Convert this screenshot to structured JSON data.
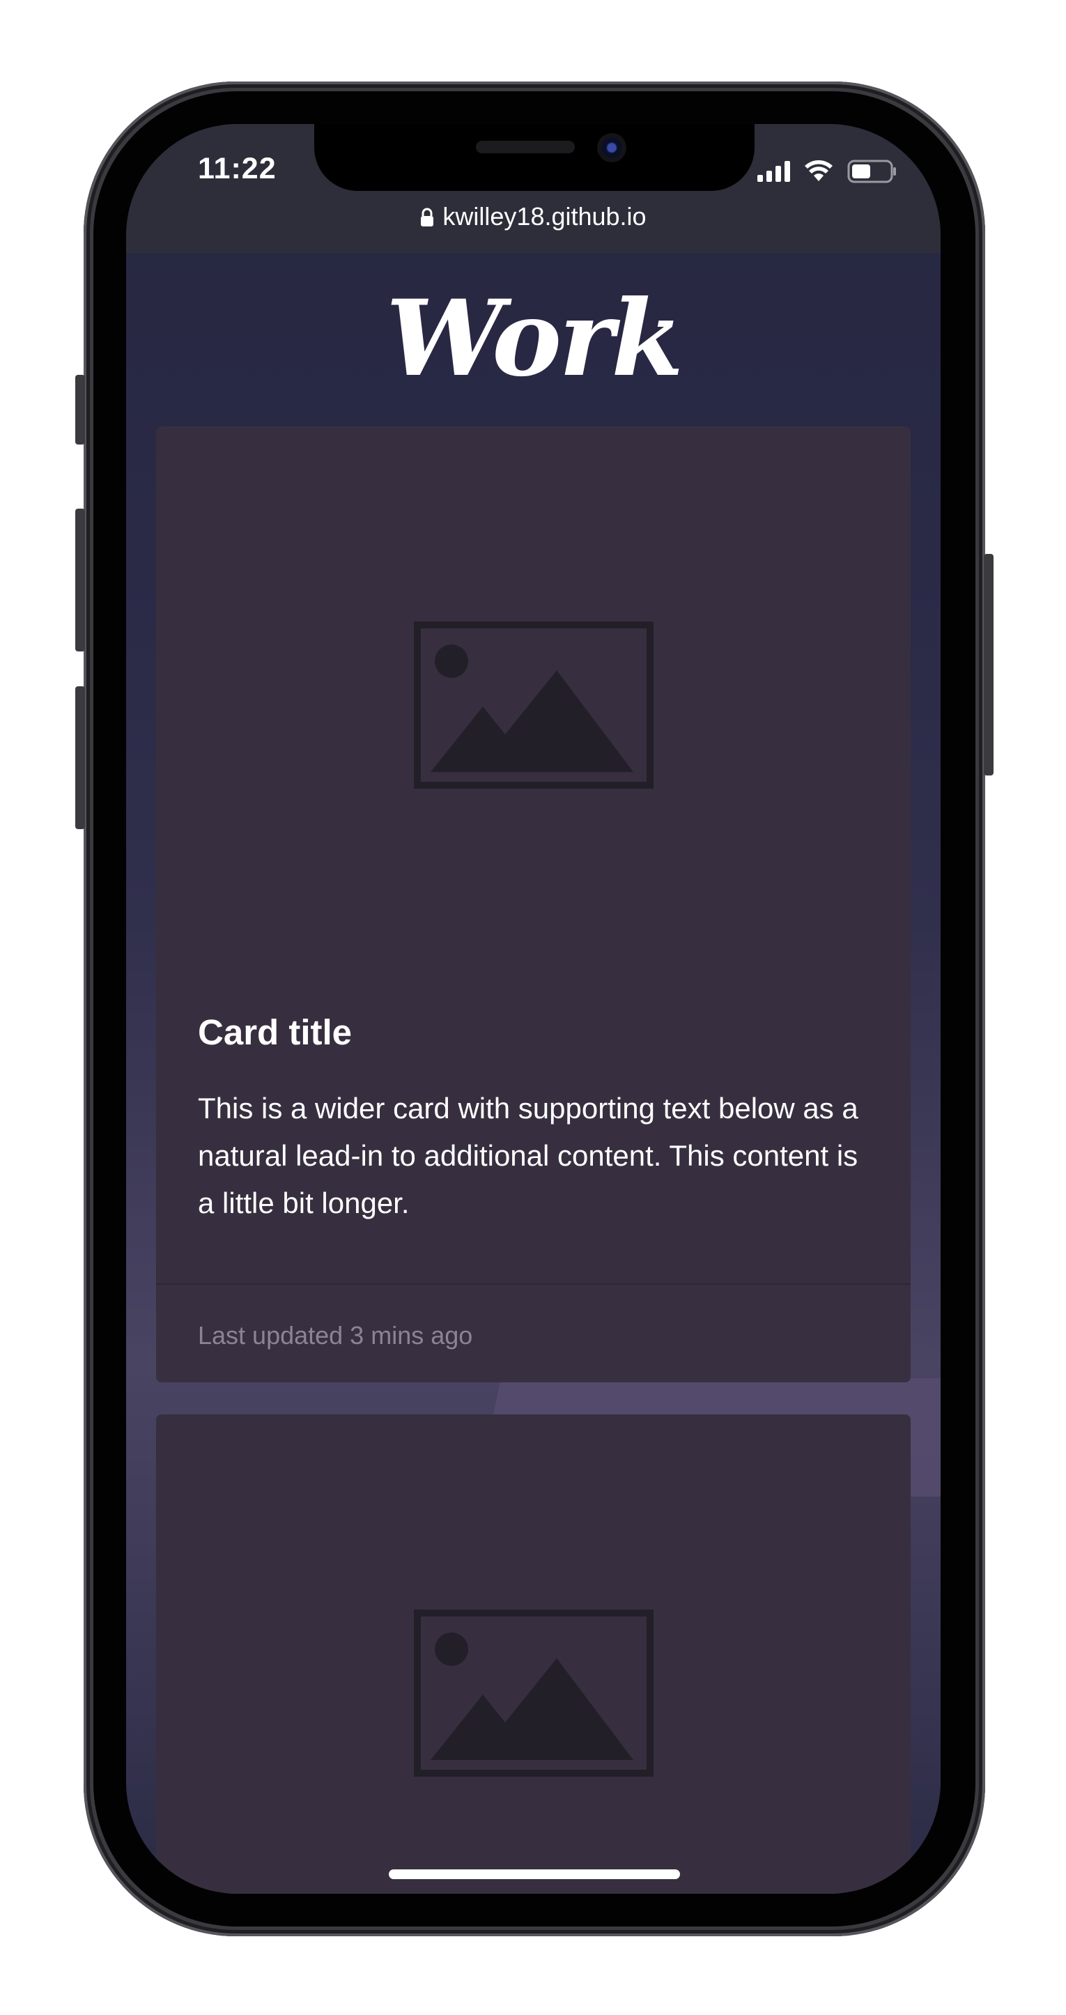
{
  "status_bar": {
    "time": "11:22",
    "address": "kwilley18.github.io"
  },
  "page": {
    "heading": "Work"
  },
  "cards": [
    {
      "title": "Card title",
      "text": "This is a wider card with supporting text below as a natural lead-in to additional content. This content is a little bit longer.",
      "footer": "Last updated 3 mins ago"
    },
    {
      "title": "",
      "text": "",
      "footer": ""
    }
  ],
  "icons": {
    "status": [
      "signal-icon",
      "wifi-icon",
      "battery-icon"
    ],
    "address": "lock-icon",
    "card_placeholder": "image-placeholder-icon"
  },
  "colors": {
    "card_background": "#372f3f",
    "placeholder_icon": "#231f28",
    "footer_text": "#8c8494"
  }
}
